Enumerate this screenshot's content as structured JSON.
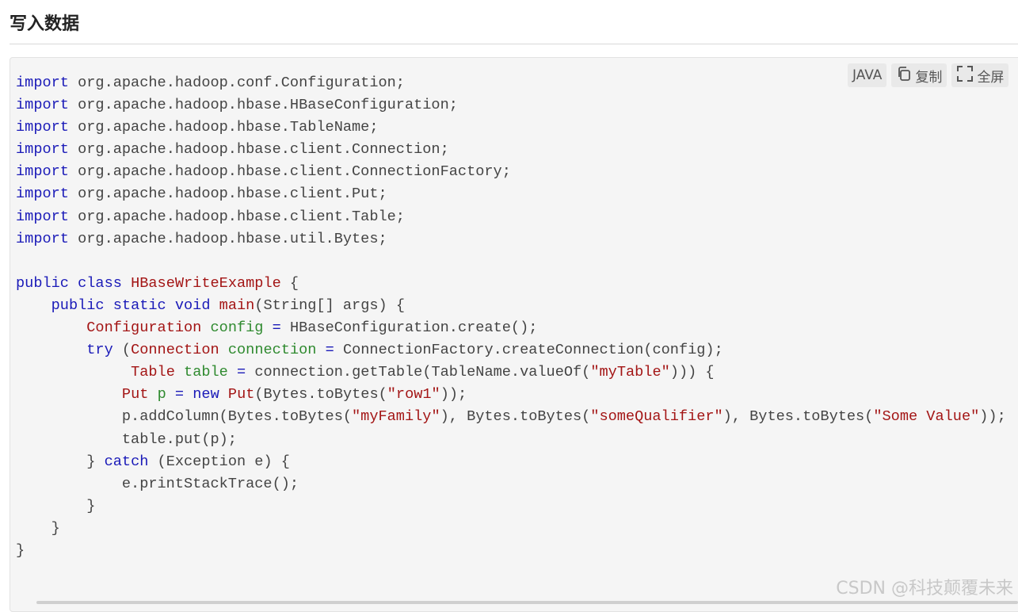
{
  "section": {
    "title": "写入数据"
  },
  "toolbar": {
    "language_label": "JAVA",
    "copy_label": "复制",
    "fullscreen_label": "全屏"
  },
  "watermark": {
    "text": "CSDN @科技颠覆未来"
  },
  "icons": {
    "copy": "copy-icon",
    "fullscreen": "fullscreen-icon"
  },
  "colors": {
    "keyword": "#1a1ab8",
    "class_name": "#a31515",
    "variable": "#2f8a2f",
    "string": "#a31515",
    "background": "#f5f5f5"
  },
  "code": {
    "language": "JAVA",
    "lines": [
      [
        [
          "kw",
          "import"
        ],
        [
          "txt",
          " org.apache.hadoop.conf.Configuration;"
        ]
      ],
      [
        [
          "kw",
          "import"
        ],
        [
          "txt",
          " org.apache.hadoop.hbase.HBaseConfiguration;"
        ]
      ],
      [
        [
          "kw",
          "import"
        ],
        [
          "txt",
          " org.apache.hadoop.hbase.TableName;"
        ]
      ],
      [
        [
          "kw",
          "import"
        ],
        [
          "txt",
          " org.apache.hadoop.hbase.client.Connection;"
        ]
      ],
      [
        [
          "kw",
          "import"
        ],
        [
          "txt",
          " org.apache.hadoop.hbase.client.ConnectionFactory;"
        ]
      ],
      [
        [
          "kw",
          "import"
        ],
        [
          "txt",
          " org.apache.hadoop.hbase.client.Put;"
        ]
      ],
      [
        [
          "kw",
          "import"
        ],
        [
          "txt",
          " org.apache.hadoop.hbase.client.Table;"
        ]
      ],
      [
        [
          "kw",
          "import"
        ],
        [
          "txt",
          " org.apache.hadoop.hbase.util.Bytes;"
        ]
      ],
      [],
      [
        [
          "kw",
          "public class"
        ],
        [
          "txt",
          " "
        ],
        [
          "cls",
          "HBaseWriteExample"
        ],
        [
          "txt",
          " {"
        ]
      ],
      [
        [
          "txt",
          "    "
        ],
        [
          "kw",
          "public static void"
        ],
        [
          "txt",
          " "
        ],
        [
          "cls",
          "main"
        ],
        [
          "txt",
          "(String[] args) {"
        ]
      ],
      [
        [
          "txt",
          "        "
        ],
        [
          "cls",
          "Configuration"
        ],
        [
          "txt",
          " "
        ],
        [
          "var",
          "config"
        ],
        [
          "txt",
          " "
        ],
        [
          "kw",
          "="
        ],
        [
          "txt",
          " HBaseConfiguration.create();"
        ]
      ],
      [
        [
          "txt",
          "        "
        ],
        [
          "kw",
          "try"
        ],
        [
          "txt",
          " ("
        ],
        [
          "cls",
          "Connection"
        ],
        [
          "txt",
          " "
        ],
        [
          "var",
          "connection"
        ],
        [
          "txt",
          " "
        ],
        [
          "kw",
          "="
        ],
        [
          "txt",
          " ConnectionFactory.createConnection(config);"
        ]
      ],
      [
        [
          "txt",
          "             "
        ],
        [
          "cls",
          "Table"
        ],
        [
          "txt",
          " "
        ],
        [
          "var",
          "table"
        ],
        [
          "txt",
          " "
        ],
        [
          "kw",
          "="
        ],
        [
          "txt",
          " connection.getTable(TableName.valueOf("
        ],
        [
          "str",
          "\"myTable\""
        ],
        [
          "txt",
          "))) {"
        ]
      ],
      [
        [
          "txt",
          "            "
        ],
        [
          "cls",
          "Put"
        ],
        [
          "txt",
          " "
        ],
        [
          "var",
          "p"
        ],
        [
          "txt",
          " "
        ],
        [
          "kw",
          "="
        ],
        [
          "txt",
          " "
        ],
        [
          "kw",
          "new"
        ],
        [
          "txt",
          " "
        ],
        [
          "cls",
          "Put"
        ],
        [
          "txt",
          "(Bytes.toBytes("
        ],
        [
          "str",
          "\"row1\""
        ],
        [
          "txt",
          "));"
        ]
      ],
      [
        [
          "txt",
          "            p.addColumn(Bytes.toBytes("
        ],
        [
          "str",
          "\"myFamily\""
        ],
        [
          "txt",
          "), Bytes.toBytes("
        ],
        [
          "str",
          "\"someQualifier\""
        ],
        [
          "txt",
          "), Bytes.toBytes("
        ],
        [
          "str",
          "\"Some Value\""
        ],
        [
          "txt",
          "));"
        ]
      ],
      [
        [
          "txt",
          "            table.put(p);"
        ]
      ],
      [
        [
          "txt",
          "        } "
        ],
        [
          "kw",
          "catch"
        ],
        [
          "txt",
          " (Exception e) {"
        ]
      ],
      [
        [
          "txt",
          "            e.printStackTrace();"
        ]
      ],
      [
        [
          "txt",
          "        }"
        ]
      ],
      [
        [
          "txt",
          "    }"
        ]
      ],
      [
        [
          "txt",
          "}"
        ]
      ]
    ]
  }
}
